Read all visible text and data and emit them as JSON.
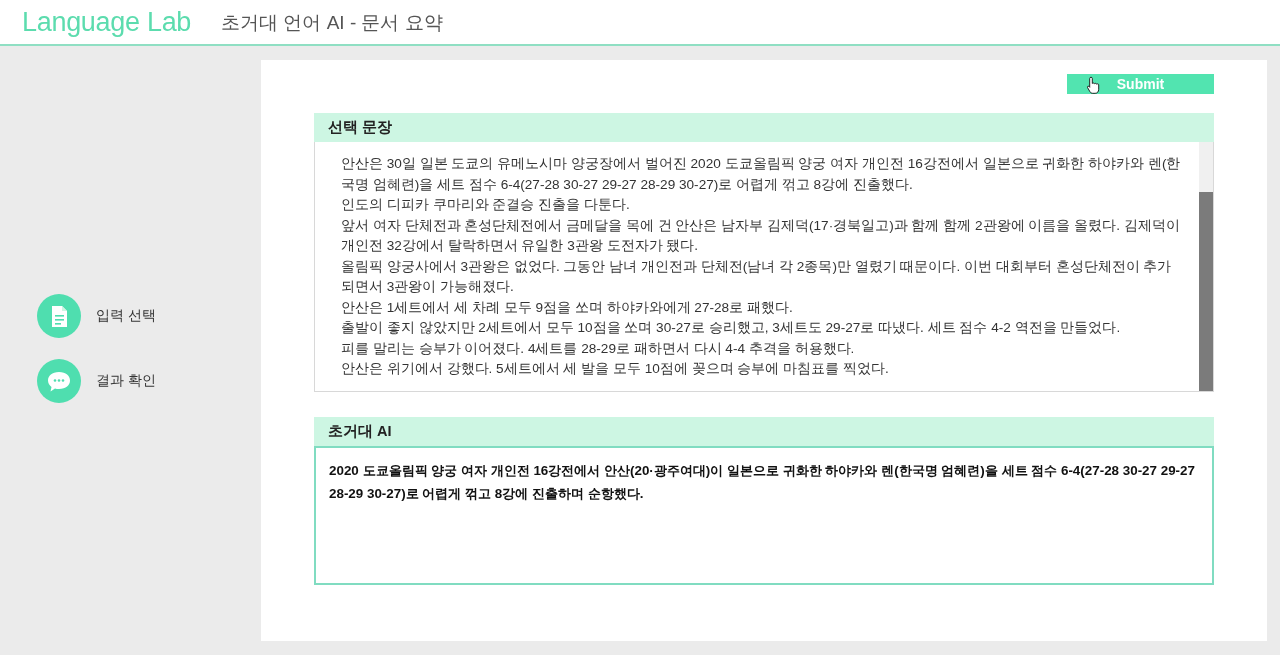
{
  "header": {
    "logo": "Language Lab",
    "title": "초거대 언어 AI - 문서 요약"
  },
  "sidebar": {
    "items": [
      {
        "label": "입력 선택",
        "kind": "document"
      },
      {
        "label": "결과 확인",
        "kind": "chat"
      }
    ]
  },
  "submit_button": {
    "label": "Submit"
  },
  "selected_sentences": {
    "title": "선택 문장",
    "paragraphs": [
      "안산은 30일 일본 도쿄의 유메노시마 양궁장에서 벌어진 2020 도쿄올림픽 양궁 여자 개인전 16강전에서 일본으로 귀화한 하야카와 렌(한국명 엄혜련)을 세트 점수 6-4(27-28 30-27 29-27 28-29 30-27)로 어렵게 꺾고 8강에 진출했다.",
      "인도의 디피카 쿠마리와 준결승 진출을 다툰다.",
      "앞서 여자 단체전과 혼성단체전에서 금메달을 목에 건 안산은 남자부 김제덕(17·경북일고)과 함께 함께 2관왕에 이름을 올렸다. 김제덕이 개인전 32강에서 탈락하면서 유일한 3관왕 도전자가 됐다.",
      "올림픽 양궁사에서 3관왕은 없었다. 그동안 남녀 개인전과 단체전(남녀 각 2종목)만 열렸기 때문이다. 이번 대회부터 혼성단체전이 추가되면서 3관왕이 가능해졌다.",
      "안산은 1세트에서 세 차례 모두 9점을 쏘며 하야카와에게 27-28로 패했다.",
      "출발이 좋지 않았지만 2세트에서 모두 10점을 쏘며 30-27로 승리했고, 3세트도 29-27로 따냈다. 세트 점수 4-2 역전을 만들었다.",
      "피를 말리는 승부가 이어졌다. 4세트를 28-29로 패하면서 다시 4-4 추격을 허용했다.",
      "안산은 위기에서 강했다. 5세트에서 세 발을 모두 10점에 꽂으며 승부에 마침표를 찍었다."
    ]
  },
  "ai_result": {
    "title": "초거대 AI",
    "text": "2020 도쿄올림픽 양궁 여자 개인전 16강전에서 안산(20·광주여대)이 일본으로 귀화한 하야카와 렌(한국명 엄혜련)을 세트 점수 6-4(27-28 30-27 29-27 28-29 30-27)로 어렵게 꺾고 8강에 진출하며 순항했다."
  }
}
